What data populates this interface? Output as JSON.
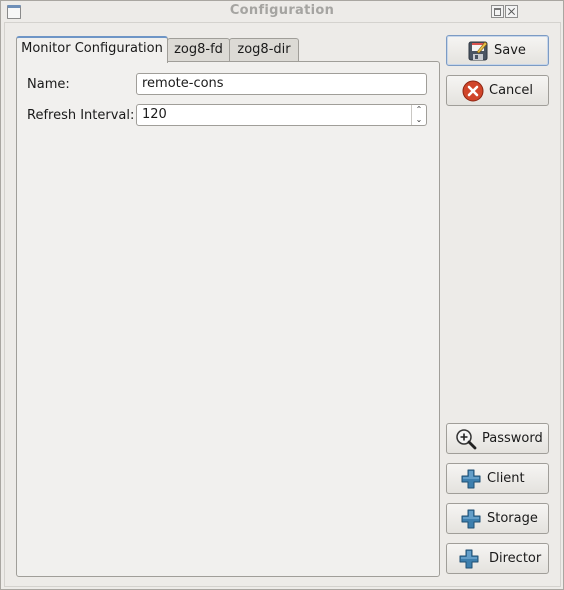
{
  "window": {
    "title": "Configuration"
  },
  "tabs": [
    {
      "label": "Monitor Configuration",
      "active": true
    },
    {
      "label": "zog8-fd",
      "active": false
    },
    {
      "label": "zog8-dir",
      "active": false
    }
  ],
  "form": {
    "name_label": "Name:",
    "name_value": "remote-cons",
    "refresh_label": "Refresh Interval:",
    "refresh_value": "120"
  },
  "buttons": {
    "save": {
      "label": "Save",
      "icon": "floppy-disk-icon"
    },
    "cancel": {
      "label": "Cancel",
      "icon": "cancel-icon"
    },
    "password": {
      "label": "Password",
      "icon": "zoom-in-icon"
    },
    "client": {
      "label": "Client",
      "icon": "plus-icon"
    },
    "storage": {
      "label": "Storage",
      "icon": "plus-icon"
    },
    "director": {
      "label": "Director",
      "icon": "plus-icon"
    }
  },
  "colors": {
    "accent": "#6e95c6",
    "cancel_red": "#d0452a",
    "plus_blue": "#3d7fae"
  }
}
